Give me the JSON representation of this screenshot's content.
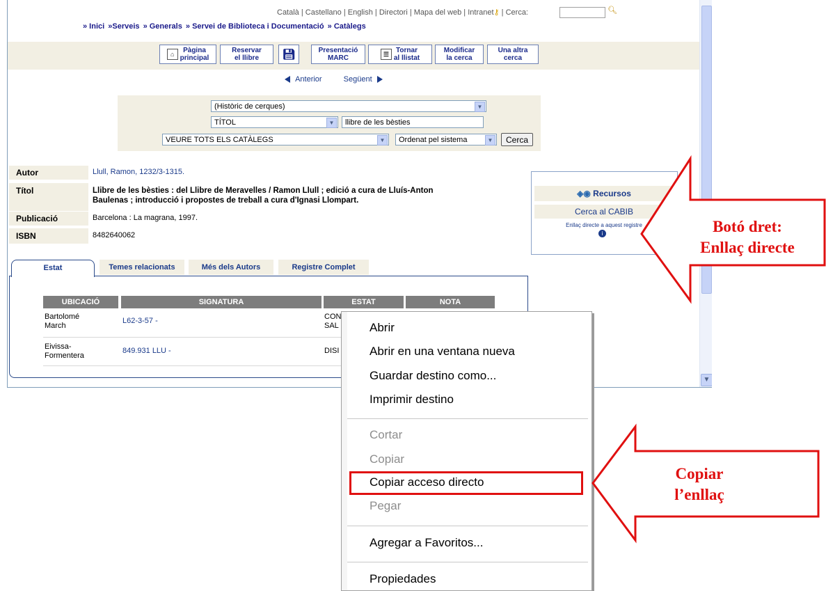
{
  "header": {
    "top_links": [
      "Català",
      "Castellano",
      "English",
      "Directori",
      "Mapa del web",
      "Intranet"
    ],
    "search_label": "Cerca:"
  },
  "breadcrumb": [
    "» Inici",
    "»Serveis",
    "» Generals",
    "» Servei de Biblioteca i Documentació",
    "» Catàlegs"
  ],
  "toolbar": {
    "buttons": [
      {
        "line1": "Pàgina",
        "line2": "principal"
      },
      {
        "line1": "Reservar",
        "line2": "el llibre"
      },
      {
        "line1": "",
        "line2": ""
      },
      {
        "line1": "Presentació",
        "line2": "MARC"
      },
      {
        "line1": "Tornar",
        "line2": "al llistat"
      },
      {
        "line1": "Modificar",
        "line2": "la cerca"
      },
      {
        "line1": "Una altra",
        "line2": "cerca"
      }
    ]
  },
  "nav": {
    "prev": "Anterior",
    "next": "Següent"
  },
  "search": {
    "history": "(Històric de cerques)",
    "field": "TÍTOL",
    "query": "llibre de les bèsties",
    "catalog": "VEURE TOTS ELS CATÀLEGS",
    "order": "Ordenat pel sistema",
    "button": "Cerca"
  },
  "record": {
    "author_label": "Autor",
    "author": "Llull, Ramon, 1232/3-1315.",
    "title_label": "Títol",
    "title_line1": "Llibre de les bèsties : del Llibre de Meravelles / Ramon Llull ; edició a cura de Lluís-Anton",
    "title_line2": "Baulenas ; introducció i propostes de treball a cura d'Ignasi Llompart.",
    "pub_label": "Publicació",
    "publication": "Barcelona : La magrana, 1997.",
    "isbn_label": "ISBN",
    "isbn": "8482640062"
  },
  "resources": {
    "title": "Recursos",
    "cabib": "Cerca al CABIB",
    "direct_link": "Enllaç directe a aquest registre"
  },
  "tabs": [
    "Estat",
    "Temes relacionats",
    "Més dels Autors",
    "Registre Complet"
  ],
  "holdings": {
    "columns": [
      "UBICACIÓ",
      "SIGNATURA",
      "ESTAT",
      "NOTA"
    ],
    "rows": [
      {
        "location1": "Bartolomé",
        "location2": "March",
        "signature": "L62-3-57",
        "status1": "CON",
        "status2": "SAL"
      },
      {
        "location1": "Eivissa-",
        "location2": "Formentera",
        "signature": "849.931 LLU",
        "status1": "DISI",
        "status2": ""
      }
    ]
  },
  "context_menu": {
    "items": [
      {
        "label": "Abrir",
        "disabled": false
      },
      {
        "label": "Abrir en una ventana nueva",
        "disabled": false
      },
      {
        "label": "Guardar destino como...",
        "disabled": false
      },
      {
        "label": "Imprimir destino",
        "disabled": false
      },
      {
        "label": "Cortar",
        "disabled": true
      },
      {
        "label": "Copiar",
        "disabled": true
      },
      {
        "label": "Copiar acceso directo",
        "disabled": false
      },
      {
        "label": "Pegar",
        "disabled": true
      },
      {
        "label": "Agregar a Favoritos...",
        "disabled": false
      },
      {
        "label": "Propiedades",
        "disabled": false
      }
    ]
  },
  "callouts": {
    "right_click_line1": "Botó dret:",
    "right_click_line2": "Enllaç directe",
    "copy_line1": "Copiar",
    "copy_line2": "l’enllaç"
  },
  "colors": {
    "accent_red": "#e01010",
    "link_blue": "#1a3a8a",
    "panel_beige": "#f2efe3"
  }
}
